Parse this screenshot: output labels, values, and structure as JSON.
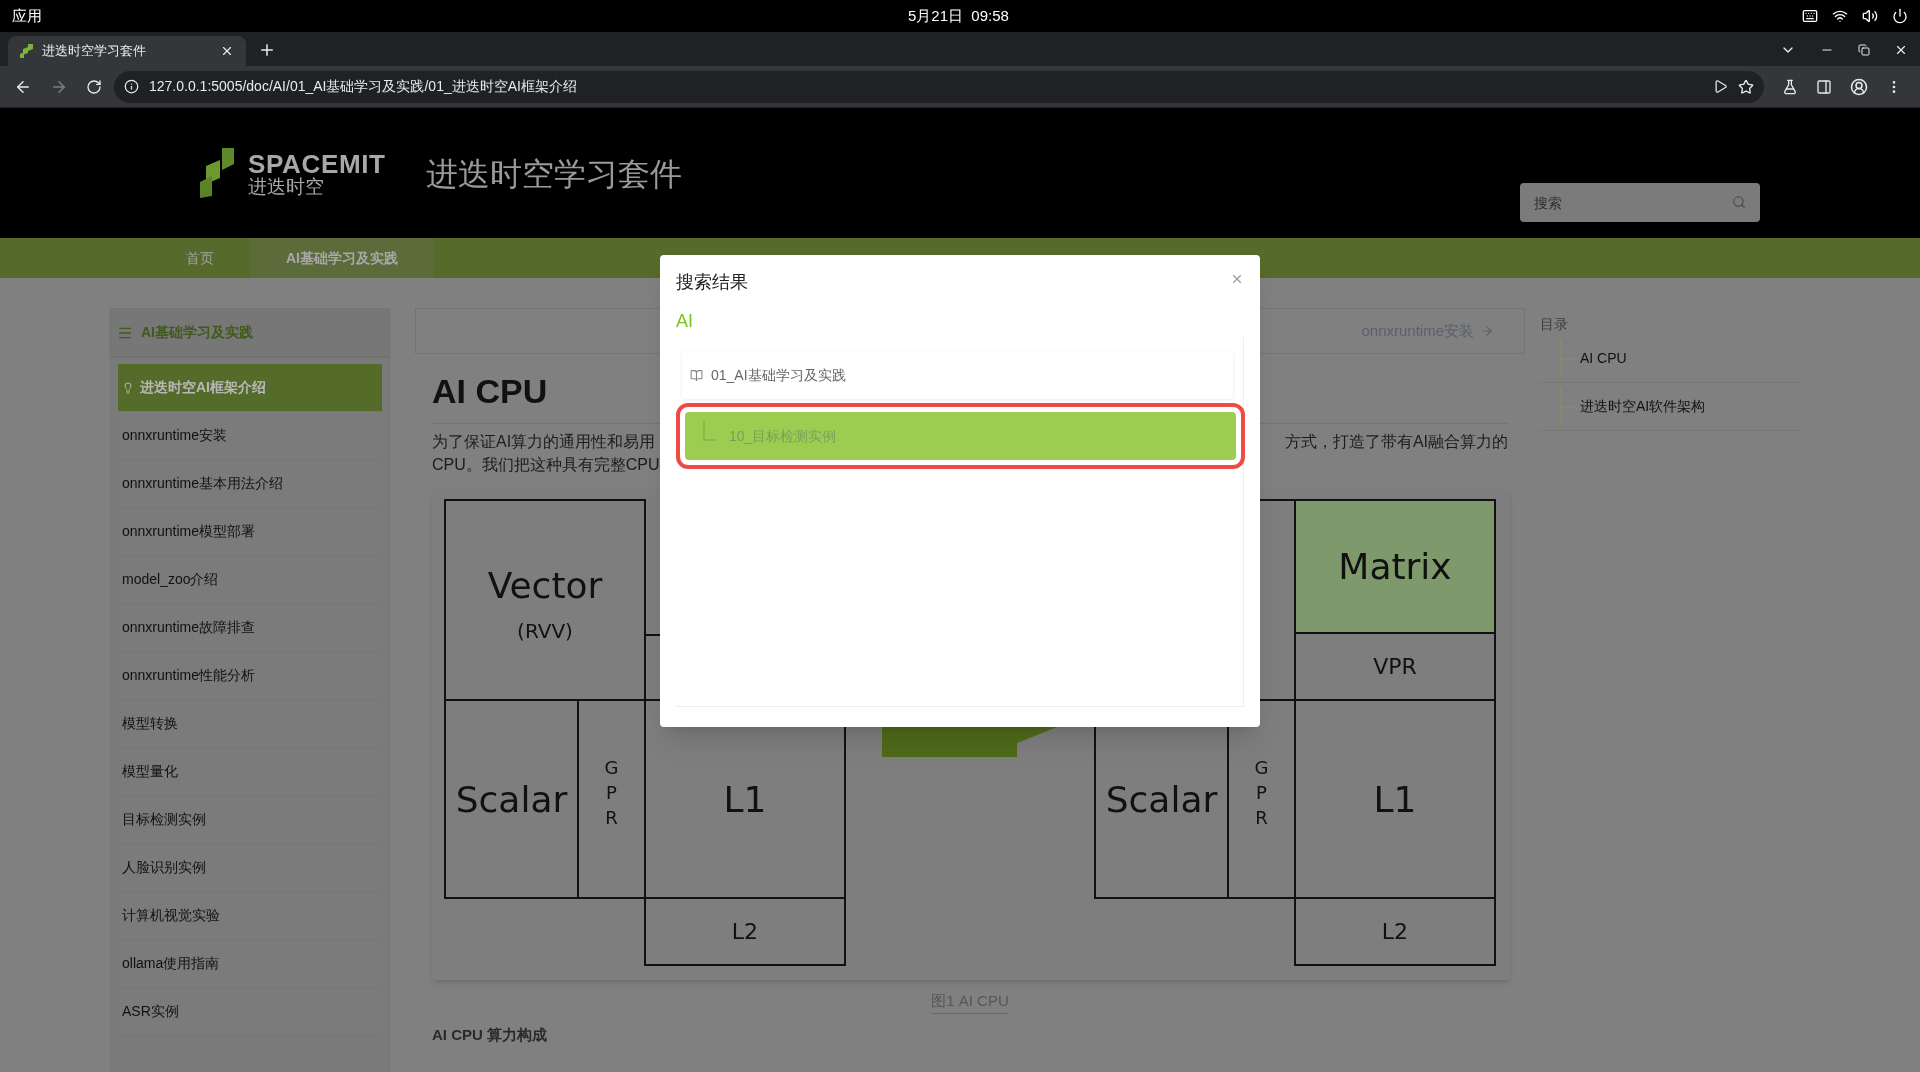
{
  "os_bar": {
    "menu": "应用",
    "clock": "5月21日  09:58"
  },
  "browser": {
    "tabs": [
      {
        "title": "进迭时空学习套件",
        "selected": true
      }
    ],
    "url": "127.0.0.1:5005/doc/AI/01_AI基础学习及实践/01_进迭时空AI框架介绍"
  },
  "header": {
    "logo_text": "SPACEMIT",
    "logo_subtext": "进迭时空",
    "site_title": "进迭时空学习套件",
    "search": {
      "placeholder": "搜索"
    }
  },
  "nav": [
    {
      "label": "首页",
      "selected": false
    },
    {
      "label": "AI基础学习及实践",
      "selected": true
    }
  ],
  "sidebar": {
    "title": "AI基础学习及实践",
    "items": [
      {
        "label": "进迭时空AI框架介绍",
        "selected": true
      },
      {
        "label": "onnxruntime安装",
        "selected": false
      },
      {
        "label": "onnxruntime基本用法介绍",
        "selected": false
      },
      {
        "label": "onnxruntime模型部署",
        "selected": false
      },
      {
        "label": "model_zoo介绍",
        "selected": false
      },
      {
        "label": "onnxruntime故障排查",
        "selected": false
      },
      {
        "label": "onnxruntime性能分析",
        "selected": false
      },
      {
        "label": "模型转换",
        "selected": false
      },
      {
        "label": "模型量化",
        "selected": false
      },
      {
        "label": "目标检测实例",
        "selected": false
      },
      {
        "label": "人脸识别实例",
        "selected": false
      },
      {
        "label": "计算机视觉实验",
        "selected": false
      },
      {
        "label": "ollama使用指南",
        "selected": false
      },
      {
        "label": "ASR实例",
        "selected": false
      }
    ]
  },
  "article": {
    "next_link": "onnxruntime安装",
    "title": "AI CPU",
    "paragraph_line_1_left": "为了保证AI算力的通用性和易用",
    "paragraph_line_1_right": "方式，打造了带有AI融合算力的",
    "paragraph_line_2_left": "CPU。我们把这种具有完整CPU",
    "figure": {
      "blocks": [
        {
          "label": "Vector",
          "sub": "(RVV)",
          "vertical": false,
          "highlighted": false
        },
        {
          "label": "Scalar",
          "vertical": false,
          "highlighted": false
        },
        {
          "label": "GPR",
          "vertical": true,
          "highlighted": false
        },
        {
          "label": "L1",
          "vertical": false,
          "highlighted": false
        },
        {
          "label": "L2",
          "vertical": false,
          "highlighted": false
        },
        {
          "label": "Matrix",
          "vertical": false,
          "highlighted": true
        },
        {
          "label": "VPR",
          "vertical": false,
          "highlighted": false
        },
        {
          "label": "Scalar",
          "vertical": false,
          "highlighted": false
        },
        {
          "label": "GPR",
          "vertical": true,
          "highlighted": false
        },
        {
          "label": "L1",
          "vertical": false,
          "highlighted": false
        },
        {
          "label": "L2",
          "vertical": false,
          "highlighted": false
        }
      ],
      "caption": "图1 AI CPU"
    },
    "subheading": "AI CPU 算力构成"
  },
  "toc": {
    "title": "目录",
    "items": [
      "AI CPU",
      "进迭时空AI软件架构"
    ]
  },
  "search_dialog": {
    "title": "搜索结果",
    "query": "AI",
    "results": [
      {
        "label": "01_AI基础学习及实践",
        "kind": "folder",
        "selected": false
      },
      {
        "label": "10_目标检测实例",
        "kind": "page",
        "selected": true
      }
    ]
  }
}
